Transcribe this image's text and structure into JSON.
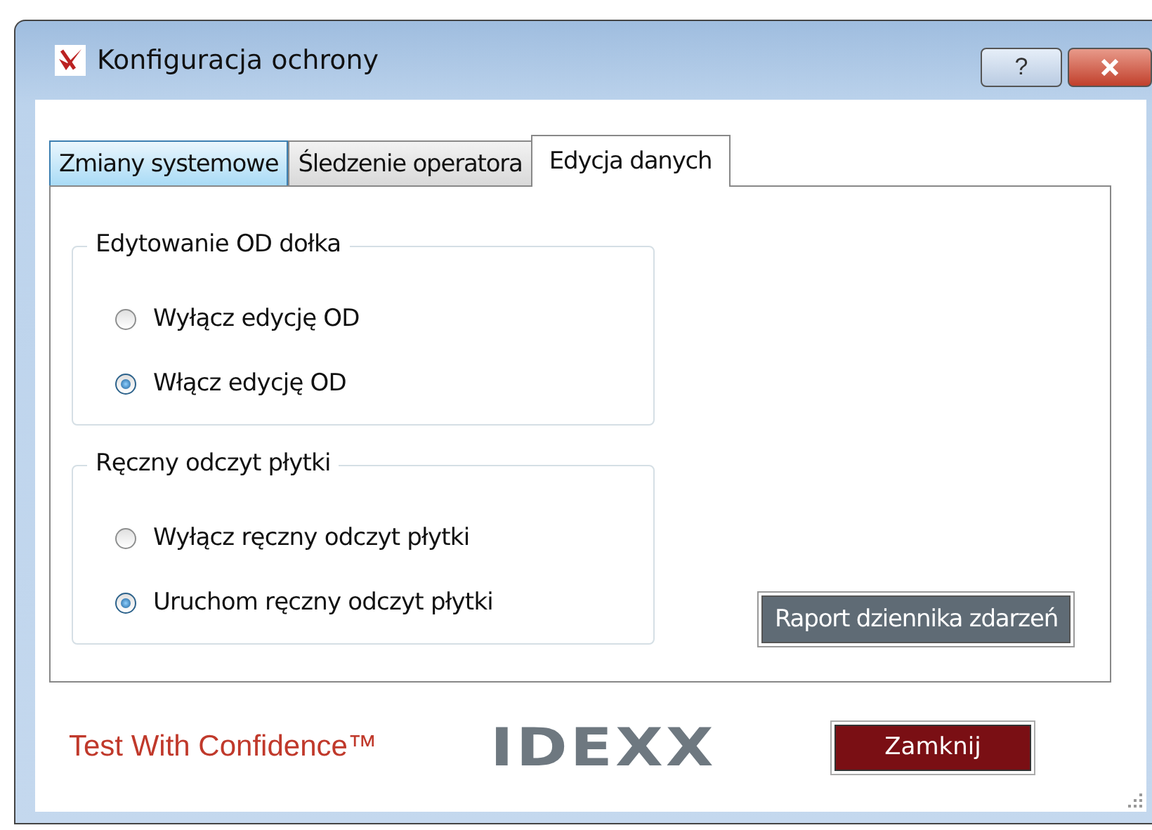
{
  "window": {
    "title": "Konfiguracja ochrony",
    "help_button": "?"
  },
  "tabs": [
    {
      "label": "Zmiany systemowe",
      "selected": false
    },
    {
      "label": "Śledzenie operatora",
      "selected": false
    },
    {
      "label": "Edycja danych",
      "selected": true
    }
  ],
  "groups": [
    {
      "title": "Edytowanie OD dołka",
      "options": [
        {
          "label": "Wyłącz edycję OD",
          "selected": false
        },
        {
          "label": "Włącz edycję OD",
          "selected": true
        }
      ]
    },
    {
      "title": "Ręczny odczyt płytki",
      "options": [
        {
          "label": "Wyłącz ręczny odczyt płytki",
          "selected": false
        },
        {
          "label": "Uruchom ręczny odczyt płytki",
          "selected": true
        }
      ]
    }
  ],
  "report_button": "Raport dziennika zdarzeń",
  "footer": {
    "slogan": "Test With Confidence™",
    "logo": "IDEXX",
    "close_button": "Zamknij"
  }
}
